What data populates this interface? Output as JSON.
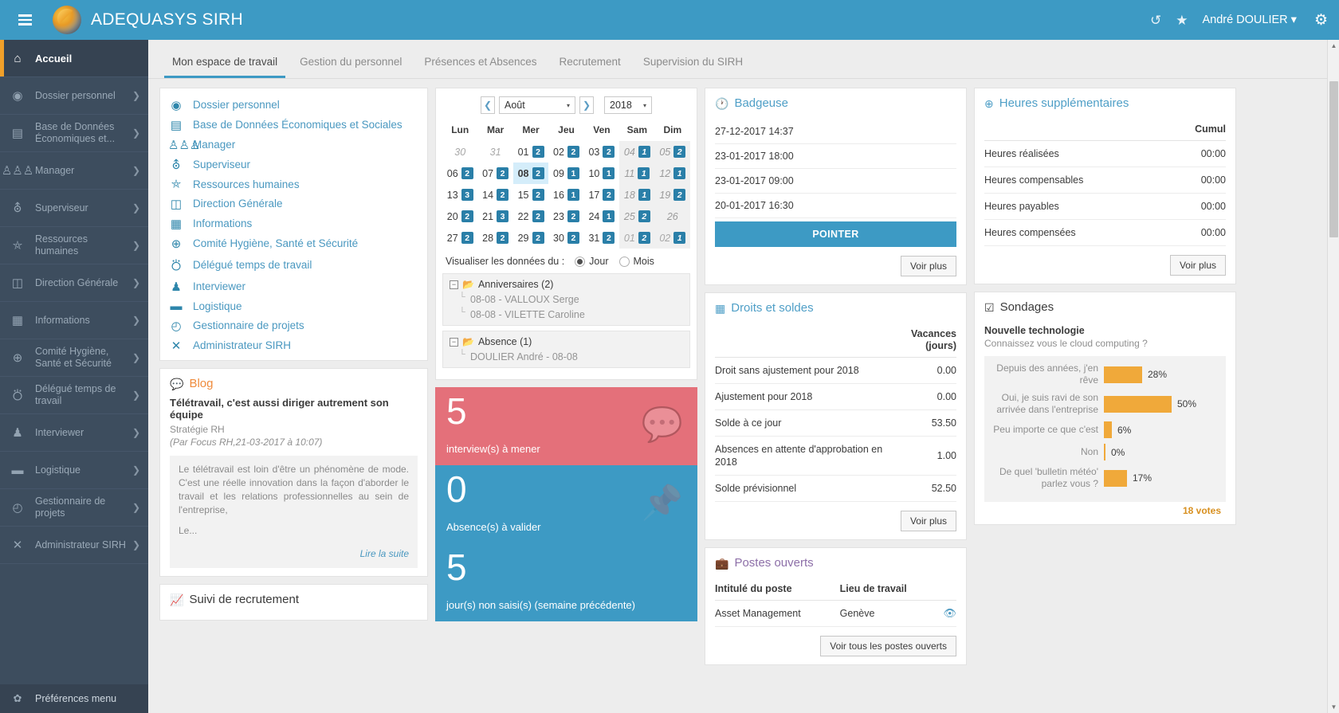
{
  "header": {
    "brand": "ADEQUASYS SIRH",
    "menu_icon": "hamburger-icon",
    "logo_icon": "adequasys-logo",
    "history_icon": "↺",
    "star_icon": "★",
    "user": "André DOULIER",
    "user_caret": "▾",
    "gear_icon": "⚙"
  },
  "sidebar": {
    "items": [
      {
        "label": "Accueil",
        "icon": "⌂",
        "active": true,
        "caret": ""
      },
      {
        "label": "Dossier personnel",
        "icon": "◉",
        "active": false,
        "caret": "❯"
      },
      {
        "label": "Base de Données Économiques et...",
        "icon": "▤",
        "active": false,
        "caret": "❯"
      },
      {
        "label": "Manager",
        "icon": "♙♙♙",
        "active": false,
        "caret": "❯"
      },
      {
        "label": "Superviseur",
        "icon": "⛢",
        "active": false,
        "caret": "❯"
      },
      {
        "label": "Ressources humaines",
        "icon": "⛤",
        "active": false,
        "caret": "❯"
      },
      {
        "label": "Direction Générale",
        "icon": "◫",
        "active": false,
        "caret": "❯"
      },
      {
        "label": "Informations",
        "icon": "▦",
        "active": false,
        "caret": "❯"
      },
      {
        "label": "Comité Hygiène, Santé et Sécurité",
        "icon": "⊕",
        "active": false,
        "caret": "❯"
      },
      {
        "label": "Délégué temps de travail",
        "icon": "⛣",
        "active": false,
        "caret": "❯"
      },
      {
        "label": "Interviewer",
        "icon": "♟",
        "active": false,
        "caret": "❯"
      },
      {
        "label": "Logistique",
        "icon": "▬",
        "active": false,
        "caret": "❯"
      },
      {
        "label": "Gestionnaire de projets",
        "icon": "◴",
        "active": false,
        "caret": "❯"
      },
      {
        "label": "Administrateur SIRH",
        "icon": "✕",
        "active": false,
        "caret": "❯"
      }
    ],
    "preferences": {
      "label": "Préférences menu",
      "icon": "✿"
    }
  },
  "tabs": [
    {
      "label": "Mon espace de travail",
      "active": true
    },
    {
      "label": "Gestion du personnel",
      "active": false
    },
    {
      "label": "Présences et Absences",
      "active": false
    },
    {
      "label": "Recrutement",
      "active": false
    },
    {
      "label": "Supervision du SIRH",
      "active": false
    }
  ],
  "quicklinks": [
    {
      "label": "Dossier personnel",
      "icon": "◉"
    },
    {
      "label": "Base de Données Économiques et Sociales",
      "icon": "▤"
    },
    {
      "label": "Manager",
      "icon": "♙♙♙"
    },
    {
      "label": "Superviseur",
      "icon": "⛢"
    },
    {
      "label": "Ressources humaines",
      "icon": "⛤"
    },
    {
      "label": "Direction Générale",
      "icon": "◫"
    },
    {
      "label": "Informations",
      "icon": "▦"
    },
    {
      "label": "Comité Hygiène, Santé et Sécurité",
      "icon": "⊕"
    },
    {
      "label": "Délégué temps de travail",
      "icon": "⛣"
    },
    {
      "label": "Interviewer",
      "icon": "♟"
    },
    {
      "label": "Logistique",
      "icon": "▬"
    },
    {
      "label": "Gestionnaire de projets",
      "icon": "◴"
    },
    {
      "label": "Administrateur SIRH",
      "icon": "✕"
    }
  ],
  "calendar": {
    "prev_icon": "❮",
    "next_icon": "❯",
    "month": "Août",
    "year": "2018",
    "caret": "▾",
    "daynames": [
      "Lun",
      "Mar",
      "Mer",
      "Jeu",
      "Ven",
      "Sam",
      "Dim"
    ],
    "weeks": [
      [
        {
          "d": "30",
          "b": "",
          "out": true,
          "we": false,
          "today": false
        },
        {
          "d": "31",
          "b": "",
          "out": true,
          "we": false,
          "today": false
        },
        {
          "d": "01",
          "b": "2",
          "out": false,
          "we": false,
          "today": false
        },
        {
          "d": "02",
          "b": "2",
          "out": false,
          "we": false,
          "today": false
        },
        {
          "d": "03",
          "b": "2",
          "out": false,
          "we": false,
          "today": false
        },
        {
          "d": "04",
          "b": "1",
          "out": false,
          "we": true,
          "today": false
        },
        {
          "d": "05",
          "b": "2",
          "out": false,
          "we": true,
          "today": false
        }
      ],
      [
        {
          "d": "06",
          "b": "2",
          "out": false,
          "we": false,
          "today": false
        },
        {
          "d": "07",
          "b": "2",
          "out": false,
          "we": false,
          "today": false
        },
        {
          "d": "08",
          "b": "2",
          "out": false,
          "we": false,
          "today": true
        },
        {
          "d": "09",
          "b": "1",
          "out": false,
          "we": false,
          "today": false
        },
        {
          "d": "10",
          "b": "1",
          "out": false,
          "we": false,
          "today": false
        },
        {
          "d": "11",
          "b": "1",
          "out": false,
          "we": true,
          "today": false
        },
        {
          "d": "12",
          "b": "1",
          "out": false,
          "we": true,
          "today": false
        }
      ],
      [
        {
          "d": "13",
          "b": "3",
          "out": false,
          "we": false,
          "today": false
        },
        {
          "d": "14",
          "b": "2",
          "out": false,
          "we": false,
          "today": false
        },
        {
          "d": "15",
          "b": "2",
          "out": false,
          "we": false,
          "today": false
        },
        {
          "d": "16",
          "b": "1",
          "out": false,
          "we": false,
          "today": false
        },
        {
          "d": "17",
          "b": "2",
          "out": false,
          "we": false,
          "today": false
        },
        {
          "d": "18",
          "b": "1",
          "out": false,
          "we": true,
          "today": false
        },
        {
          "d": "19",
          "b": "2",
          "out": false,
          "we": true,
          "today": false
        }
      ],
      [
        {
          "d": "20",
          "b": "2",
          "out": false,
          "we": false,
          "today": false
        },
        {
          "d": "21",
          "b": "3",
          "out": false,
          "we": false,
          "today": false
        },
        {
          "d": "22",
          "b": "2",
          "out": false,
          "we": false,
          "today": false
        },
        {
          "d": "23",
          "b": "2",
          "out": false,
          "we": false,
          "today": false
        },
        {
          "d": "24",
          "b": "1",
          "out": false,
          "we": false,
          "today": false
        },
        {
          "d": "25",
          "b": "2",
          "out": false,
          "we": true,
          "today": false
        },
        {
          "d": "26",
          "b": "",
          "out": false,
          "we": true,
          "today": false
        }
      ],
      [
        {
          "d": "27",
          "b": "2",
          "out": false,
          "we": false,
          "today": false
        },
        {
          "d": "28",
          "b": "2",
          "out": false,
          "we": false,
          "today": false
        },
        {
          "d": "29",
          "b": "2",
          "out": false,
          "we": false,
          "today": false
        },
        {
          "d": "30",
          "b": "2",
          "out": false,
          "we": false,
          "today": false
        },
        {
          "d": "31",
          "b": "2",
          "out": false,
          "we": false,
          "today": false
        },
        {
          "d": "01",
          "b": "2",
          "out": true,
          "we": true,
          "today": false
        },
        {
          "d": "02",
          "b": "1",
          "out": true,
          "we": true,
          "today": false
        }
      ]
    ],
    "viz_label": "Visualiser les données du :",
    "viz_options": [
      {
        "label": "Jour",
        "selected": true
      },
      {
        "label": "Mois",
        "selected": false
      }
    ],
    "trees": [
      {
        "title": "Anniversaires (2)",
        "items": [
          "08-08 - VALLOUX Serge",
          "08-08 - VILETTE Caroline"
        ]
      },
      {
        "title": "Absence (1)",
        "items": [
          "DOULIER André - 08-08"
        ]
      }
    ]
  },
  "blog": {
    "panel_title": "Blog",
    "panel_icon": "speech-bubbles-icon",
    "title": "Télétravail, c'est aussi diriger autrement son équipe",
    "category": "Stratégie RH",
    "meta": "(Par Focus RH,21-03-2017 à 10:07)",
    "excerpt": "Le télétravail est loin d'être un phénomène de mode. C'est une réelle innovation dans la façon d'aborder le travail et les relations professionnelles au sein de l'entreprise,",
    "ellipsis": "Le...",
    "more": "Lire la suite"
  },
  "recruitment_panel": {
    "title": "Suivi de recrutement",
    "icon": "chart-line-icon"
  },
  "stats": [
    {
      "number": "5",
      "label": "interview(s) à mener",
      "color": "red",
      "icon": "speech-bubbles-icon"
    },
    {
      "number": "0",
      "label": "Absence(s) à valider",
      "color": "blue",
      "icon": "pin-icon"
    },
    {
      "number": "5",
      "label": "jour(s) non saisi(s) (semaine précédente)",
      "color": "blue",
      "icon": ""
    }
  ],
  "badgeuse": {
    "title": "Badgeuse",
    "icon": "clock-icon",
    "entries": [
      "27-12-2017 14:37",
      "23-01-2017 18:00",
      "23-01-2017 09:00",
      "20-01-2017 16:30"
    ],
    "button": "POINTER",
    "more": "Voir plus"
  },
  "droits": {
    "title": "Droits et soldes",
    "icon": "table-icon",
    "col_header": "Vacances (jours)",
    "rows": [
      {
        "label": "Droit sans ajustement pour 2018",
        "value": "0.00"
      },
      {
        "label": "Ajustement pour 2018",
        "value": "0.00"
      },
      {
        "label": "Solde à ce jour",
        "value": "53.50"
      },
      {
        "label": "Absences en attente d'approbation en 2018",
        "value": "1.00"
      },
      {
        "label": "Solde prévisionnel",
        "value": "52.50"
      }
    ],
    "more": "Voir plus"
  },
  "heures": {
    "title": "Heures supplémentaires",
    "icon": "plus-circle-icon",
    "col_header": "Cumul",
    "rows": [
      {
        "label": "Heures réalisées",
        "value": "00:00"
      },
      {
        "label": "Heures compensables",
        "value": "00:00"
      },
      {
        "label": "Heures payables",
        "value": "00:00"
      },
      {
        "label": "Heures compensées",
        "value": "00:00"
      }
    ],
    "more": "Voir plus"
  },
  "postes": {
    "title": "Postes ouverts",
    "icon": "briefcase-icon",
    "columns": [
      "Intitulé du poste",
      "Lieu de travail",
      ""
    ],
    "rows": [
      {
        "poste": "Asset Management",
        "lieu": "Genève",
        "action_icon": "👁"
      }
    ],
    "button": "Voir tous les postes ouverts"
  },
  "sondages": {
    "title": "Sondages",
    "icon": "checkbox-icon",
    "poll_title": "Nouvelle technologie",
    "question": "Connaissez vous le cloud computing ?",
    "votes": "18 votes"
  },
  "chart_data": {
    "type": "bar",
    "title": "Nouvelle technologie",
    "subtitle": "Connaissez vous le cloud computing ?",
    "orientation": "horizontal",
    "categories": [
      "Depuis des années, j'en rêve",
      "Oui, je suis ravi de son arrivée dans l'entreprise",
      "Peu importe ce que c'est",
      "Non",
      "De quel 'bulletin météo' parlez vous ?"
    ],
    "values": [
      28,
      50,
      6,
      0,
      17
    ],
    "value_labels": [
      "28%",
      "50%",
      "6%",
      "0%",
      "17%"
    ],
    "unit": "%",
    "total_label": "18 votes",
    "bar_color": "#f0a93a",
    "xlabel": "",
    "ylabel": "",
    "xlim": [
      0,
      100
    ],
    "grid": false,
    "legend": "none"
  }
}
